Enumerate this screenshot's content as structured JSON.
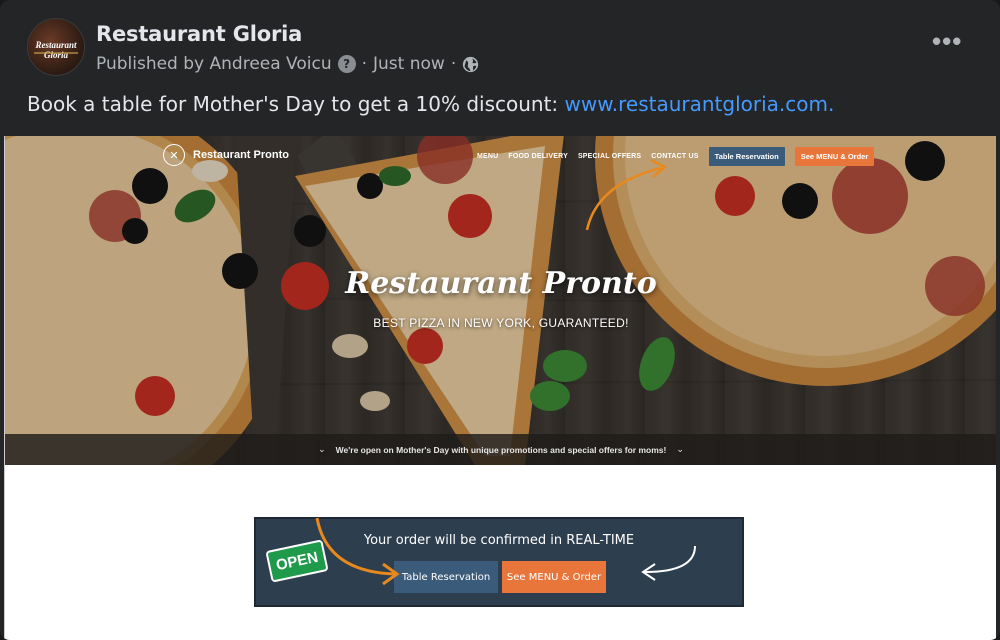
{
  "post": {
    "page_name": "Restaurant Gloria",
    "avatar_text": "Restaurant Gloria",
    "published_by": "Published by Andreea Voicu",
    "help_glyph": "?",
    "separator": "·",
    "time": "Just now",
    "text": "Book a table for Mother's Day to get a 10% discount: ",
    "link": "www.restaurantgloria.com.",
    "more_glyph": "•••",
    "icons": [
      "help-icon",
      "globe-icon",
      "more-options-icon"
    ]
  },
  "site": {
    "logo_text": "Restaurant Pronto",
    "logo_glyph": "✕",
    "nav": [
      "MENU",
      "FOOD DELIVERY",
      "SPECIAL OFFERS",
      "CONTACT US"
    ],
    "nav_reservation": "Table Reservation",
    "nav_order": "See MENU & Order",
    "hero_title": "Restaurant Pronto",
    "hero_subtitle": "BEST PIZZA IN NEW YORK, GUARANTEED!",
    "banner": "We're open on Mother's Day with unique promotions and special offers for moms!",
    "chevron": "⌄"
  },
  "widget": {
    "open_sign": "OPEN",
    "title": "Your order will be confirmed in REAL-TIME",
    "reservation": "Table Reservation",
    "order": "See MENU & Order"
  },
  "colors": {
    "post_bg": "#242526",
    "link": "#4599ff",
    "button_blue": "#3b5b7a",
    "button_orange": "#e8763b",
    "arrow_orange": "#e8891e",
    "open_green": "#1f9a4b"
  }
}
